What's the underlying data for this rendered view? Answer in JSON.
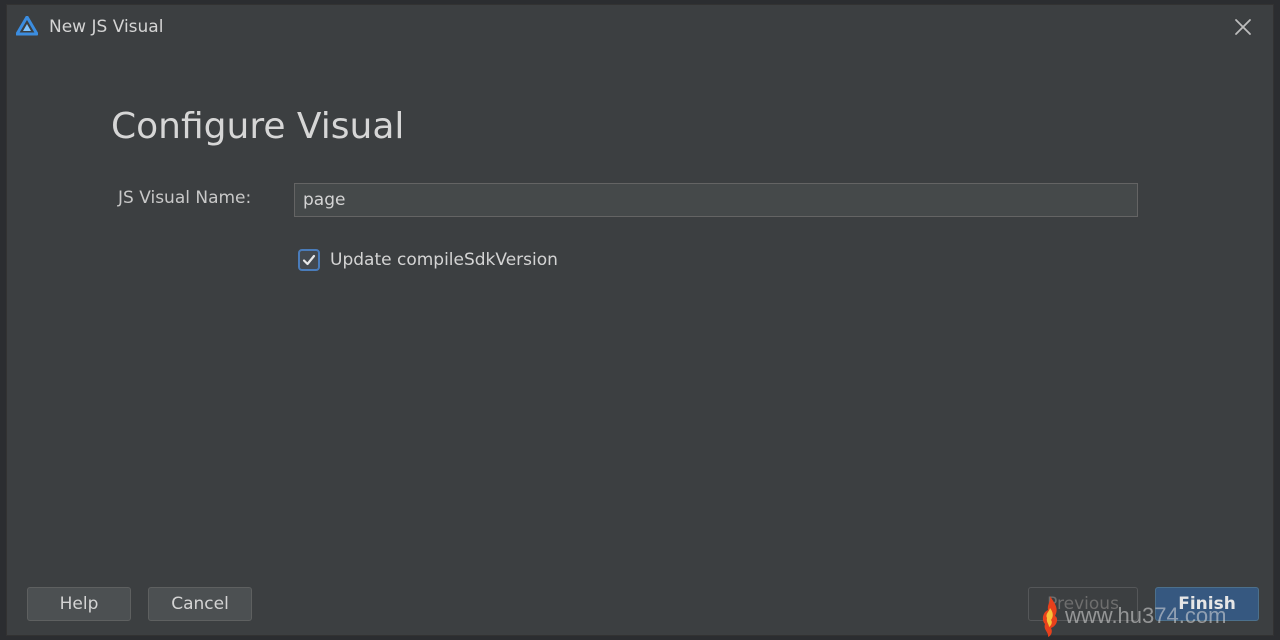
{
  "window": {
    "title": "New JS Visual",
    "app_icon": "harmony-app-icon",
    "close_icon": "close-icon"
  },
  "main": {
    "heading": "Configure Visual",
    "name_label": "JS Visual Name:",
    "name_value": "page",
    "checkbox_label": "Update compileSdkVersion",
    "checkbox_checked": true
  },
  "footer": {
    "help_label": "Help",
    "cancel_label": "Cancel",
    "previous_label": "Previous",
    "finish_label": "Finish"
  },
  "watermark": {
    "text": "www.hu374.com"
  },
  "colors": {
    "dialog_bg": "#3c3f41",
    "accent": "#365880",
    "checkbox_border": "#4a7cba"
  }
}
